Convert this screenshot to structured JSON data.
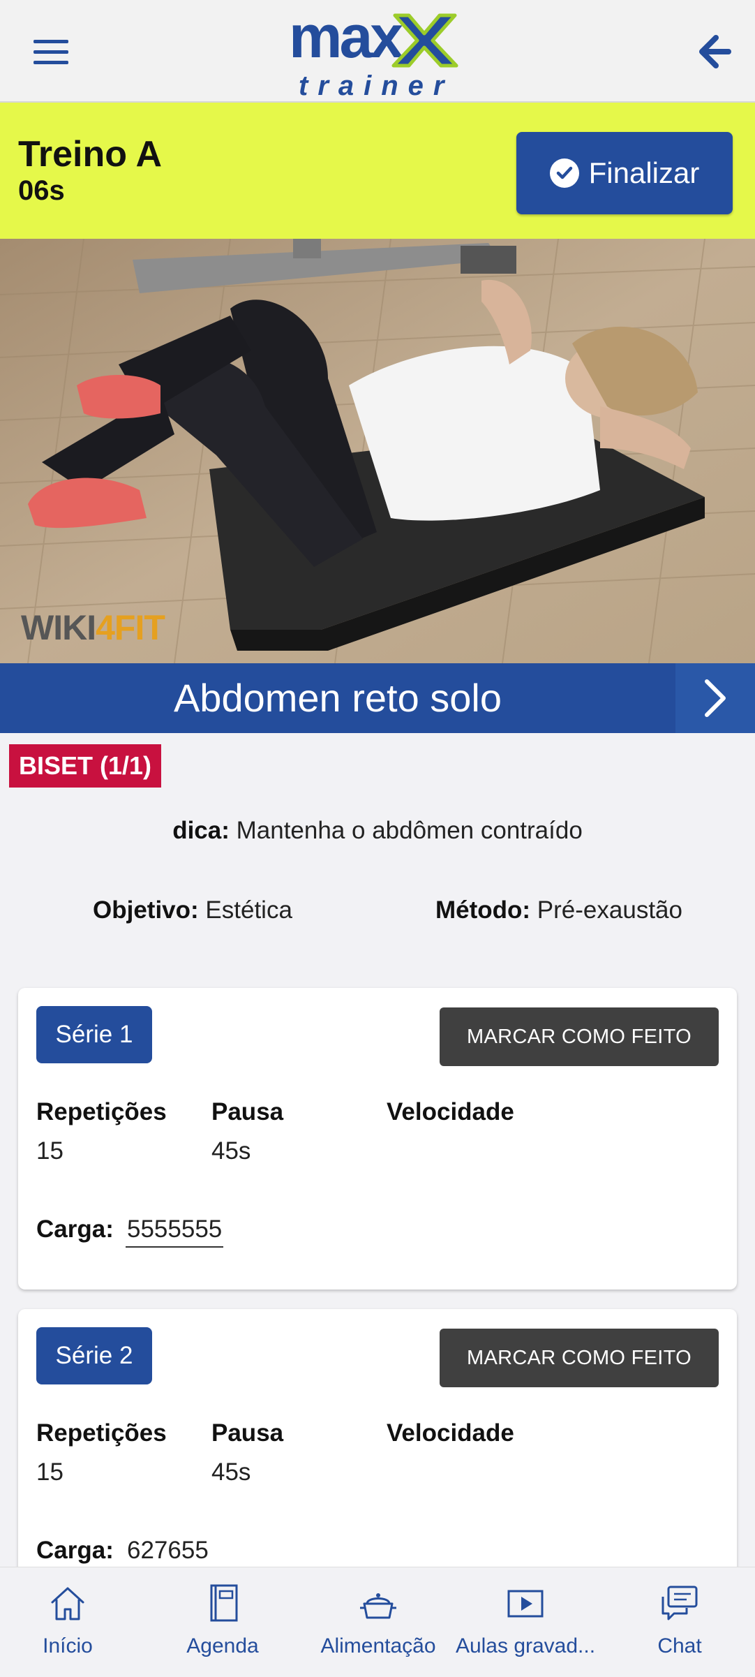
{
  "header": {
    "logo_top": "max",
    "logo_bottom": "trainer",
    "menu_icon": "hamburger-menu-icon",
    "back_icon": "arrow-left-icon"
  },
  "workout": {
    "title": "Treino A",
    "timer": "06s",
    "finish_label": "Finalizar"
  },
  "exercise": {
    "image_watermark_1": "WIKI",
    "image_watermark_2": "4FIT",
    "name": "Abdomen reto solo",
    "badge": "BISET (1/1)",
    "tip_label": "dica:",
    "tip_text": " Mantenha o abdômen contraído",
    "objective_label": "Objetivo:",
    "objective_value": " Estética",
    "method_label": "Método:",
    "method_value": " Pré-exaustão"
  },
  "series": [
    {
      "label": "Série 1",
      "mark_done": "MARCAR COMO FEITO",
      "reps_label": "Repetições",
      "reps": "15",
      "pause_label": "Pausa",
      "pause": "45s",
      "speed_label": "Velocidade",
      "speed": "",
      "load_label": "Carga:",
      "load": "5555555"
    },
    {
      "label": "Série 2",
      "mark_done": "MARCAR COMO FEITO",
      "reps_label": "Repetições",
      "reps": "15",
      "pause_label": "Pausa",
      "pause": "45s",
      "speed_label": "Velocidade",
      "speed": "",
      "load_label": "Carga:",
      "load": "627655"
    }
  ],
  "nav": [
    {
      "label": "Início",
      "icon": "home-icon"
    },
    {
      "label": "Agenda",
      "icon": "notebook-icon"
    },
    {
      "label": "Alimentação",
      "icon": "food-pot-icon"
    },
    {
      "label": "Aulas gravad...",
      "icon": "video-play-icon"
    },
    {
      "label": "Chat",
      "icon": "chat-icon"
    }
  ],
  "colors": {
    "brand_blue": "#244d9c",
    "accent_yellow": "#e5f84a",
    "badge_red": "#c8113f",
    "button_dark": "#404040",
    "logo_green": "#9ccc2a"
  }
}
